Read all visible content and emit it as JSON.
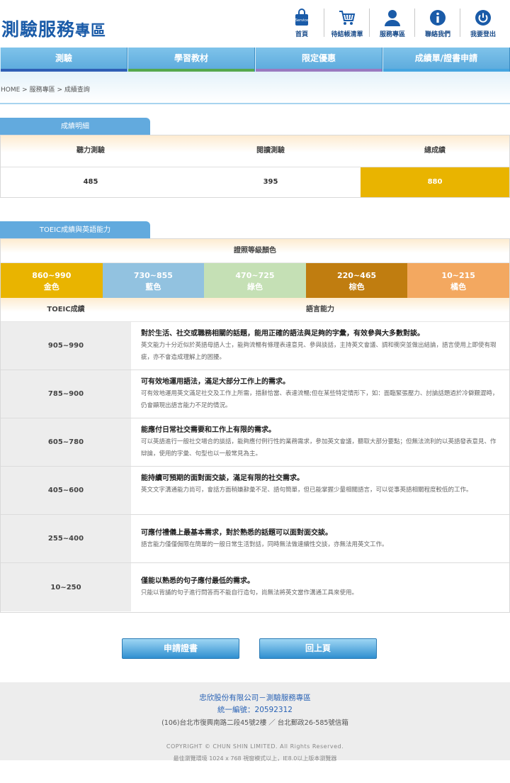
{
  "header": {
    "title_main": "測驗服務",
    "title_small": "專區",
    "nav": [
      {
        "label": "首頁",
        "icon": "service-bag-icon"
      },
      {
        "label": "待結帳清單",
        "icon": "cart-icon"
      },
      {
        "label": "服務專區",
        "icon": "user-icon"
      },
      {
        "label": "聯絡我們",
        "icon": "info-icon"
      },
      {
        "label": "我要登出",
        "icon": "power-icon"
      }
    ],
    "service_badge": "Service"
  },
  "main_nav": [
    {
      "label": "測驗",
      "bar_color": "#2f5fb5"
    },
    {
      "label": "學習教材",
      "bar_color": "#55a84d"
    },
    {
      "label": "限定優惠",
      "bar_color": "#9a7ac0"
    },
    {
      "label": "成績單/證書申請",
      "bar_color": "#45a5e0"
    }
  ],
  "breadcrumb": {
    "home": "HOME",
    "sep": " > ",
    "section": "服務專區",
    "current": "成績查詢"
  },
  "score_section": {
    "tab": "成績明細",
    "headers": [
      "聽力測驗",
      "閱讀測驗",
      "總成績"
    ],
    "values": [
      "485",
      "395",
      "880"
    ]
  },
  "toeic_section": {
    "tab": "TOEIC成績與英語能力",
    "color_title": "證照等級顏色",
    "levels": [
      {
        "range": "860~990",
        "name": "金色",
        "color": "#e9b400"
      },
      {
        "range": "730~855",
        "name": "藍色",
        "color": "#92c2e0"
      },
      {
        "range": "470~725",
        "name": "綠色",
        "color": "#c5e0b5"
      },
      {
        "range": "220~465",
        "name": "棕色",
        "color": "#c07d10"
      },
      {
        "range": "10~215",
        "name": "橘色",
        "color": "#f3a860"
      }
    ],
    "col_score": "TOEIC成績",
    "col_ability": "語言能力",
    "rows": [
      {
        "score": "905~990",
        "main": "對於生活、社交或職務相關的話題，能用正確的語法與足夠的字彙，有效參與大多數對談。",
        "detail": "英文能力十分近似於英語母語人士，能夠流暢有條理表達意見、參與談話，主持英文會議、調和衝突並做出結論，語言使用上即使有瑕疵，亦不會造成理解上的困擾。"
      },
      {
        "score": "785~900",
        "main": "可有效地運用語法，滿足大部分工作上的需求。",
        "detail": "可有效地運用英文滿足社交及工作上所需，措辭恰當、表達流暢;但在某些特定情形下，如：面臨緊張壓力、討論話題過於冷僻艱澀時，仍會顯現出語言能力不足的情況。"
      },
      {
        "score": "605~780",
        "main": "能應付日常社交需要和工作上有限的需求。",
        "detail": "可以英語進行一般社交場合的談話，能夠應付例行性的業務需求，參加英文會議，聽取大部分要點；但無法流利的以英語發表意見、作辯論，使用的字彙、句型也以一般常見為主。"
      },
      {
        "score": "405~600",
        "main": "能持續可預期的面對面交談，滿足有限的社交需求。",
        "detail": "英文文字溝通能力尚可，會話方面稍嫌辭彙不足、語句簡單，但已能掌握少量相關語言，可以從事英語相關程度較低的工作。"
      },
      {
        "score": "255~400",
        "main": "可應付禮儀上最基本需求，對於熟悉的話題可以面對面交談。",
        "detail": "語言能力僅僅侷限在簡單的一般日常生活對話，同時無法做連續性交談，亦無法用英文工作。"
      },
      {
        "score": "10~250",
        "main": "僅能以熟悉的句子應付最低的需求。",
        "detail": "只能以背誦的句子進行問答而不能自行造句，尚無法將英文當作溝通工具來使用。"
      }
    ]
  },
  "buttons": {
    "apply": "申請證書",
    "back": "回上頁"
  },
  "footer": {
    "company": "忠欣股份有限公司－測驗服務專區",
    "taxid": "統一編號：20592312",
    "address": "(106)台北市復興南路二段45號2樓 ／ 台北郵政26-585號信箱",
    "copyright": "COPYRIGHT © CHUN SHIN LIMITED. All Rights Reserved.",
    "browser": "最佳瀏覽環境 1024 x 768 視窗模式以上，IE8.0以上版本瀏覽器"
  }
}
